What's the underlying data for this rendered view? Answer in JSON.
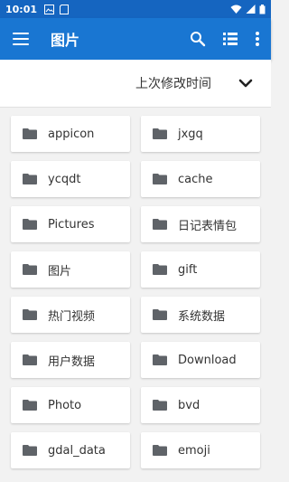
{
  "status_bar": {
    "time": "10:01"
  },
  "app_bar": {
    "title": "图片"
  },
  "sort": {
    "label": "上次修改时间"
  },
  "folders": [
    {
      "name": "appicon"
    },
    {
      "name": "jxgq"
    },
    {
      "name": "ycqdt"
    },
    {
      "name": "cache"
    },
    {
      "name": "Pictures"
    },
    {
      "name": "日记表情包"
    },
    {
      "name": "图片"
    },
    {
      "name": "gift"
    },
    {
      "name": "热门视频"
    },
    {
      "name": "系统数据"
    },
    {
      "name": "用户数据"
    },
    {
      "name": "Download"
    },
    {
      "name": "Photo"
    },
    {
      "name": "bvd"
    },
    {
      "name": "gdal_data"
    },
    {
      "name": "emoji"
    }
  ],
  "colors": {
    "app_bar": "#1976d2",
    "status_bar": "#1565c0",
    "folder_icon": "#5f6368"
  }
}
